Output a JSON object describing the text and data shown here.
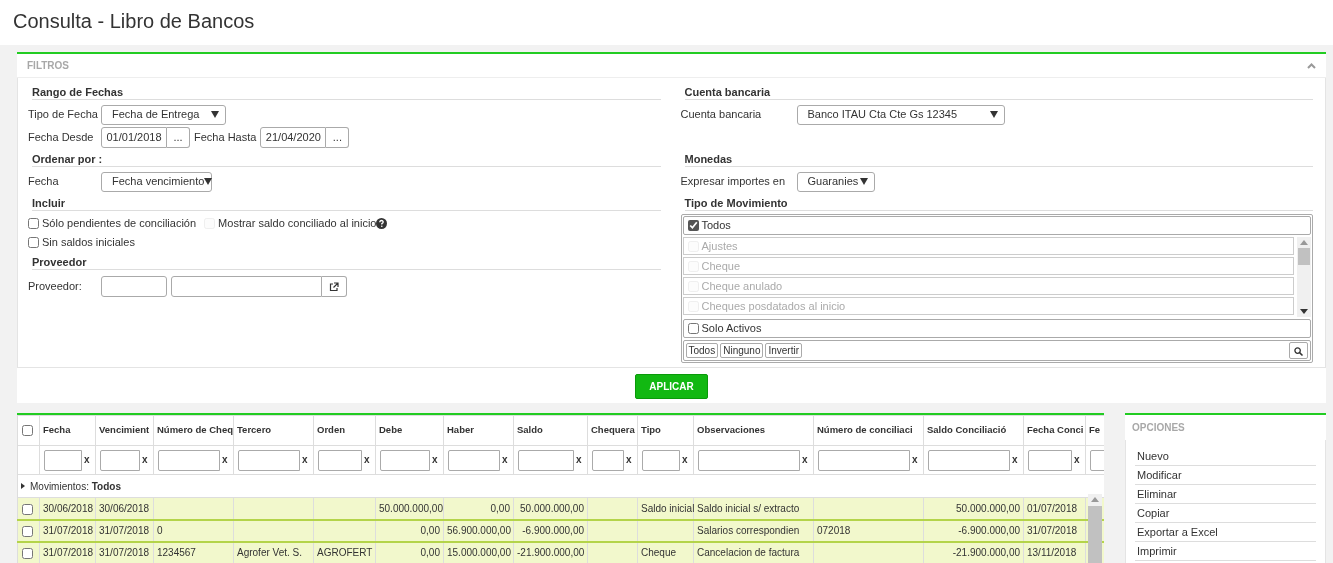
{
  "page_title": "Consulta - Libro de Bancos",
  "filters": {
    "title": "FILTROS",
    "date_range": {
      "heading": "Rango de Fechas",
      "date_type": {
        "label": "Tipo de Fecha",
        "value": "Fecha de Entrega"
      },
      "from": {
        "label": "Fecha Desde",
        "value": "01/01/2018",
        "button": "..."
      },
      "to": {
        "label": "Fecha Hasta",
        "value": "21/04/2020",
        "button": "..."
      }
    },
    "order": {
      "heading": "Ordenar por :",
      "label": "Fecha",
      "value": "Fecha vencimiento"
    },
    "include": {
      "heading": "Incluir",
      "rows": [
        [
          {
            "label": "Sólo pendientes de conciliación",
            "checked": false,
            "disabled": false,
            "help": false
          },
          {
            "label": "Mostrar saldo conciliado al inicio",
            "checked": false,
            "disabled": true,
            "help": true
          }
        ],
        [
          {
            "label": "Sin saldos iniciales",
            "checked": false,
            "disabled": false,
            "help": false
          }
        ]
      ]
    },
    "provider": {
      "heading": "Proveedor",
      "label": "Proveedor:"
    },
    "bank_account": {
      "heading": "Cuenta bancaria",
      "label": "Cuenta bancaria",
      "value": "Banco ITAU Cta Cte Gs 12345"
    },
    "currency": {
      "heading": "Monedas",
      "label": "Expresar importes en",
      "value": "Guaranies"
    },
    "movement_type": {
      "heading": "Tipo de Movimiento",
      "all": {
        "label": "Todos",
        "checked": true
      },
      "items": [
        {
          "label": "Ajustes",
          "checked": false,
          "disabled": true
        },
        {
          "label": "Cheque",
          "checked": false,
          "disabled": true
        },
        {
          "label": "Cheque anulado",
          "checked": false,
          "disabled": true
        },
        {
          "label": "Cheques posdatados al inicio",
          "checked": false,
          "disabled": true
        }
      ],
      "active_only": {
        "label": "Solo Activos",
        "checked": false
      },
      "buttons": [
        "Todos",
        "Ninguno",
        "Invertir"
      ]
    },
    "apply_button": "APLICAR"
  },
  "table": {
    "select_all": {
      "checked": false
    },
    "columns": [
      {
        "label": "Fecha",
        "clear": "x"
      },
      {
        "label": "Vencimient",
        "clear": "x"
      },
      {
        "label": "Número de Cheq",
        "clear": "x"
      },
      {
        "label": "Tercero",
        "clear": "x"
      },
      {
        "label": "Orden",
        "clear": "x"
      },
      {
        "label": "Debe",
        "clear": "x"
      },
      {
        "label": "Haber",
        "clear": "x"
      },
      {
        "label": "Saldo",
        "clear": "x"
      },
      {
        "label": "Chequera",
        "clear": "x"
      },
      {
        "label": "Tipo",
        "clear": "x"
      },
      {
        "label": "Observaciones",
        "clear": "x"
      },
      {
        "label": "Número de conciliaci",
        "clear": "x"
      },
      {
        "label": "Saldo Conciliació",
        "clear": "x"
      },
      {
        "label": "Fecha Conci",
        "clear": "x"
      },
      {
        "label": "Fe"
      }
    ],
    "group_row": {
      "label": "Movimientos:",
      "value": "Todos"
    },
    "rows": [
      {
        "selected": false,
        "cells": [
          "30/06/2018",
          "30/06/2018",
          null,
          null,
          null,
          "50.000.000,00",
          "0,00",
          "50.000.000,00",
          null,
          "Saldo inicial",
          "Saldo inicial s/ extracto",
          null,
          "50.000.000,00",
          "01/07/2018"
        ]
      },
      {
        "selected": false,
        "cells": [
          "31/07/2018",
          "31/07/2018",
          "0",
          null,
          null,
          "0,00",
          "56.900.000,00",
          "-6.900.000,00",
          null,
          null,
          "Salarios correspondien",
          "072018",
          "-6.900.000,00",
          "31/07/2018"
        ]
      },
      {
        "selected": false,
        "cells": [
          "31/07/2018",
          "31/07/2018",
          "1234567",
          "Agrofer Vet. S.",
          "AGROFERT",
          "0,00",
          "15.000.000,00",
          "-21.900.000,00",
          null,
          "Cheque",
          "Cancelacion de factura",
          null,
          "-21.900.000,00",
          "13/11/2018"
        ]
      }
    ]
  },
  "options": {
    "title": "OPCIONES",
    "items": [
      "Nuevo",
      "Modificar",
      "Eliminar",
      "Copiar",
      "Exportar a Excel",
      "Imprimir"
    ]
  }
}
